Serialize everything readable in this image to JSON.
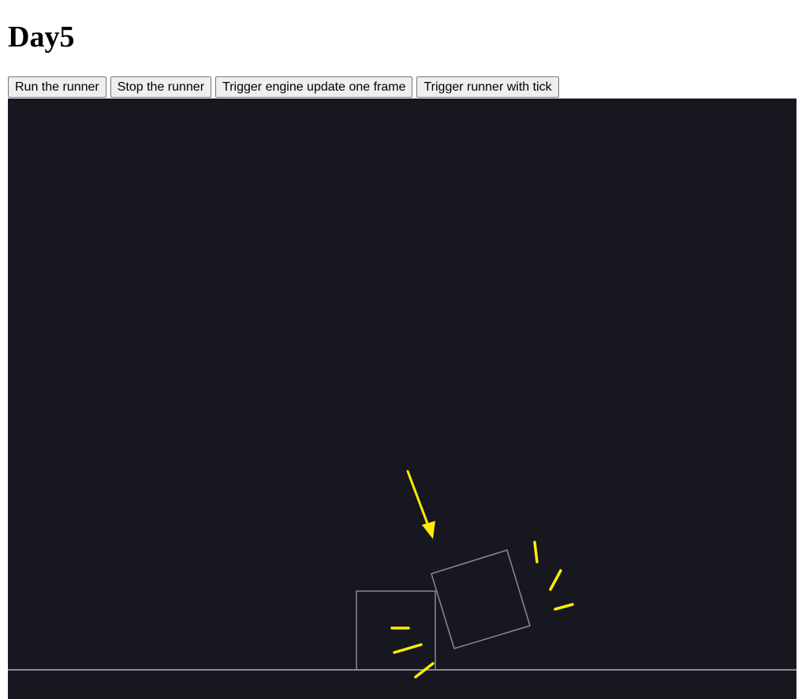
{
  "page": {
    "title": "Day5"
  },
  "toolbar": {
    "run_label": "Run the runner",
    "stop_label": "Stop the runner",
    "update_label": "Trigger engine update one frame",
    "tick_label": "Trigger runner with tick"
  },
  "scene": {
    "background_color": "#171720",
    "outline_color": "#8a8a94",
    "accent_color": "#ffee00",
    "bodies": [
      "ground",
      "box-upright",
      "box-tilted"
    ],
    "effects": [
      "falling-arrow",
      "motion-lines"
    ]
  }
}
